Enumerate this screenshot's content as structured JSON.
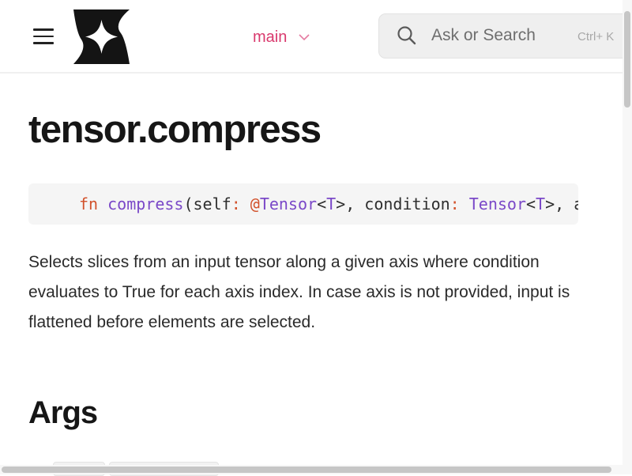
{
  "header": {
    "branch": "main",
    "search_placeholder": "Ask or Search",
    "search_shortcut": "Ctrl+ K",
    "brand_color": "#d93a6e"
  },
  "page": {
    "title": "tensor.compress",
    "signature": [
      {
        "t": "fn",
        "c": "kw"
      },
      {
        "t": " ",
        "c": "pl"
      },
      {
        "t": "compress",
        "c": "fnn"
      },
      {
        "t": "(self",
        "c": "pl"
      },
      {
        "t": ": @",
        "c": "op"
      },
      {
        "t": "Tensor",
        "c": "ty"
      },
      {
        "t": "<",
        "c": "pl"
      },
      {
        "t": "T",
        "c": "ty"
      },
      {
        "t": ">, condition",
        "c": "pl"
      },
      {
        "t": ": ",
        "c": "op"
      },
      {
        "t": "Tensor",
        "c": "ty"
      },
      {
        "t": "<",
        "c": "pl"
      },
      {
        "t": "T",
        "c": "ty"
      },
      {
        "t": ">, axis",
        "c": "pl"
      }
    ],
    "description": "Selects slices from an input tensor along a given axis where condition evaluates to True for each axis index. In case axis is not provided, input is flattened before elements are selected.",
    "args_heading": "Args"
  }
}
